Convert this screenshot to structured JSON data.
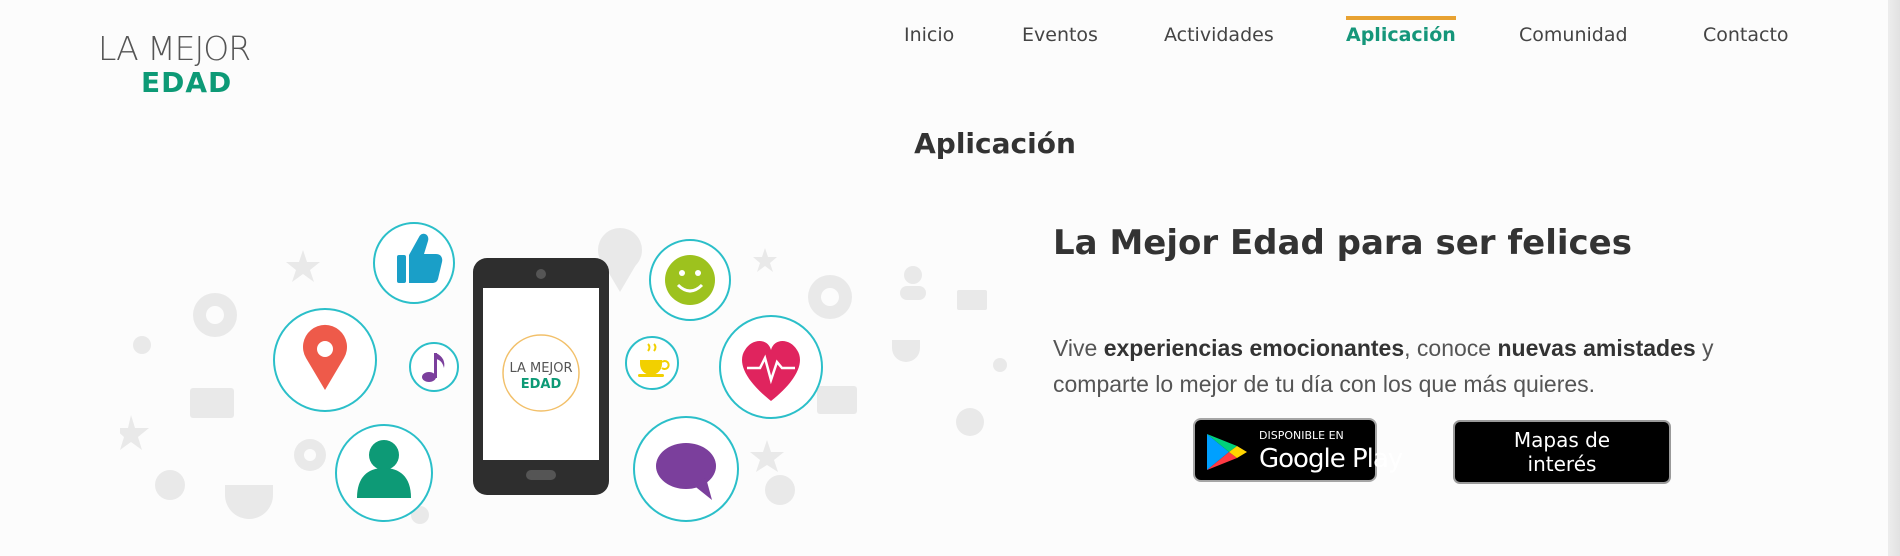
{
  "header": {
    "logo": {
      "line1": "LA MEJOR",
      "line2": "EDAD"
    },
    "nav": [
      {
        "label": "Inicio",
        "active": false
      },
      {
        "label": "Eventos",
        "active": false
      },
      {
        "label": "Actividades",
        "active": false
      },
      {
        "label": "Aplicación",
        "active": true
      },
      {
        "label": "Comunidad",
        "active": false
      },
      {
        "label": "Contacto",
        "active": false
      }
    ]
  },
  "main": {
    "title": "Aplicación",
    "illustration": {
      "phone_logo": {
        "line1": "LA MEJOR",
        "line2": "EDAD"
      },
      "icons": [
        "thumbs-up-icon",
        "location-pin-icon",
        "music-note-icon",
        "user-icon",
        "smiley-icon",
        "coffee-cup-icon",
        "heart-pulse-icon",
        "chat-bubble-icon"
      ]
    },
    "headline": "La Mejor Edad para ser felices",
    "description": {
      "part1": "Vive ",
      "bold1": "experiencias emocionantes",
      "part2": ", conoce ",
      "bold2": "nuevas amistades",
      "part3": " y comparte lo mejor de tu día con los que más quieres."
    },
    "google_play": {
      "small": "DISPONIBLE EN",
      "big": "Google Play"
    },
    "maps_button": "Mapas de interés"
  },
  "colors": {
    "accent_green": "#0d9a76",
    "nav_active_border": "#e8a232",
    "circle_border": "#2bbfc9",
    "pin_red": "#ee5a4a",
    "smiley_green": "#9dc21e",
    "heart_red": "#e0245e",
    "chat_purple": "#7b3f9c"
  }
}
